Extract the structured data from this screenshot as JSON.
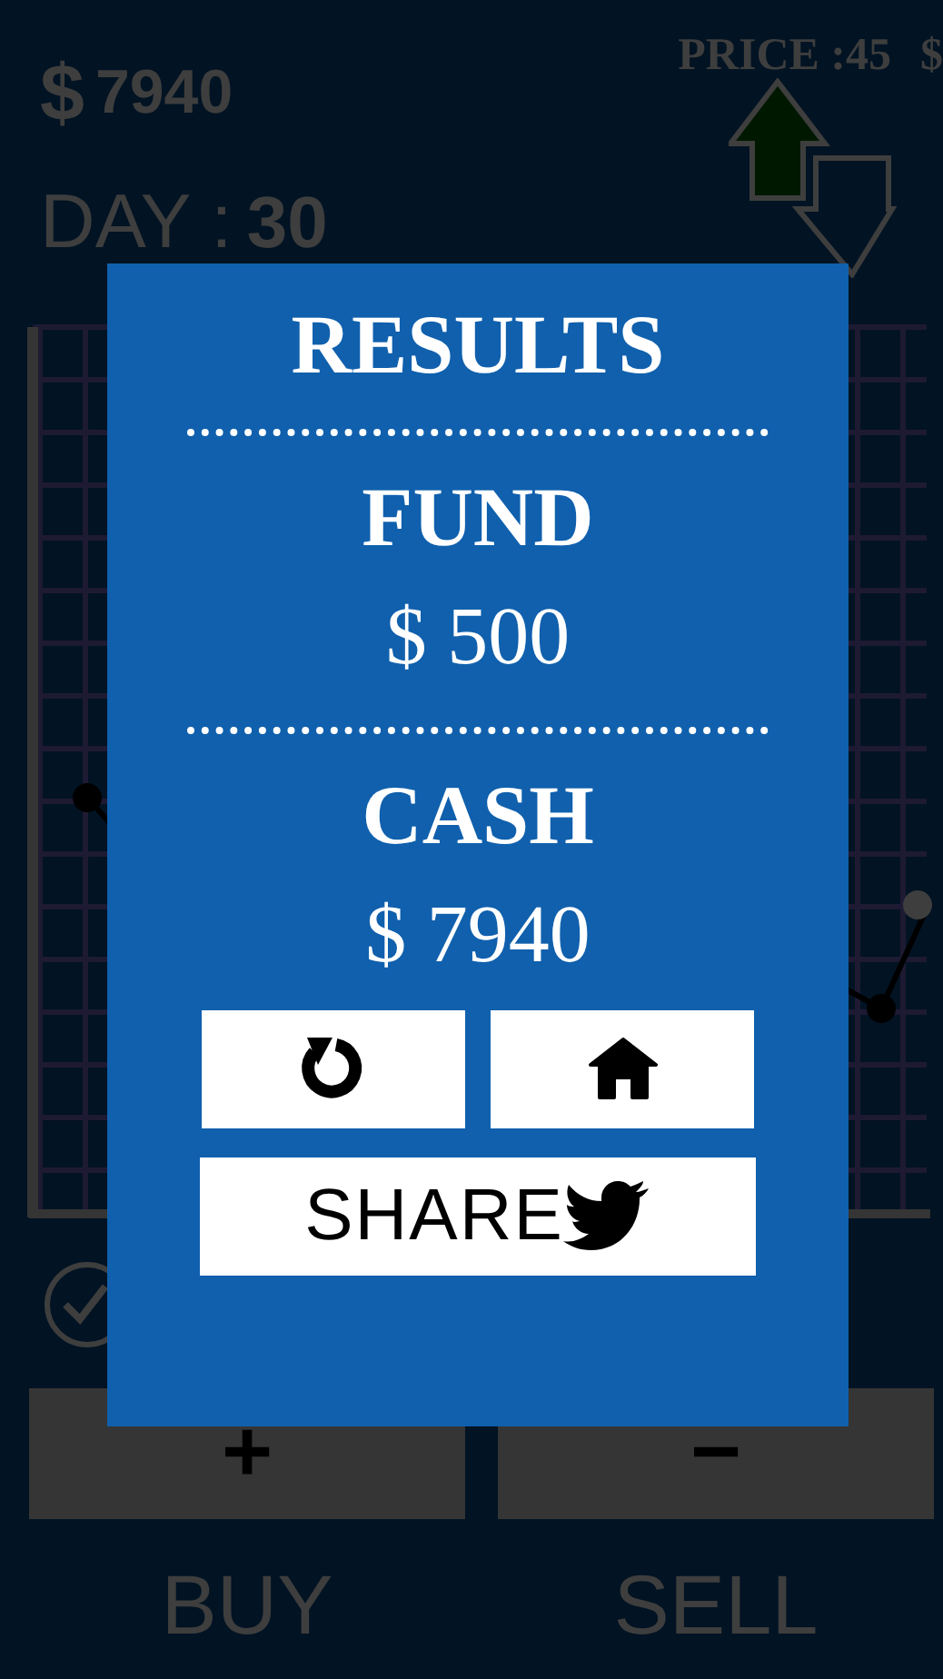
{
  "header": {
    "cash_symbol": "$",
    "cash": "7940",
    "day_label": "DAY :",
    "day": "30",
    "price_label": "PRICE :45",
    "price_currency": "$"
  },
  "controls": {
    "buy_key": "+",
    "sell_key": "−",
    "buy_label": "BUY",
    "sell_label": "SELL"
  },
  "results": {
    "title": "RESULTS",
    "sections": [
      {
        "label": "FUND",
        "value": "$ 500"
      },
      {
        "label": "CASH",
        "value": "$ 7940"
      }
    ],
    "share_label": "SHARE"
  }
}
